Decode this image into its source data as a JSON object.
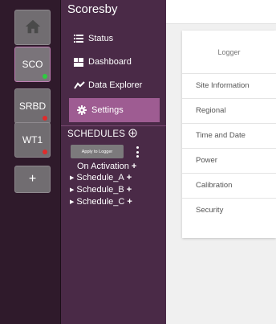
{
  "rail": {
    "loggers": [
      {
        "label": "SCO",
        "active": true,
        "status_color": "#2ecc40"
      },
      {
        "label": "SRBD",
        "active": false,
        "status_color": "#e02b2b"
      },
      {
        "label": "WT1",
        "active": false,
        "status_color": "#e02b2b"
      }
    ],
    "add_label": "+"
  },
  "sidebar": {
    "title": "Scoresby",
    "nav": [
      {
        "label": "Status",
        "icon": "list-icon"
      },
      {
        "label": "Dashboard",
        "icon": "dashboard-icon"
      },
      {
        "label": "Data Explorer",
        "icon": "chart-line-icon"
      },
      {
        "label": "Settings",
        "icon": "gear-icon",
        "active": true
      }
    ],
    "schedules": {
      "heading": "SCHEDULES",
      "apply_label": "Apply to Logger",
      "on_activation": "On Activation",
      "items": [
        "Schedule_A",
        "Schedule_B",
        "Schedule_C"
      ]
    }
  },
  "main": {
    "card": {
      "header": "Logger",
      "items": [
        "Site Information",
        "Regional",
        "Time and Date",
        "Power",
        "Calibration",
        "Security"
      ]
    }
  },
  "colors": {
    "rail_bg": "#2f1a2b",
    "sidebar_bg": "#4a2a47",
    "active_nav": "#9e5c92",
    "status_green": "#2ecc40",
    "status_red": "#e02b2b"
  }
}
